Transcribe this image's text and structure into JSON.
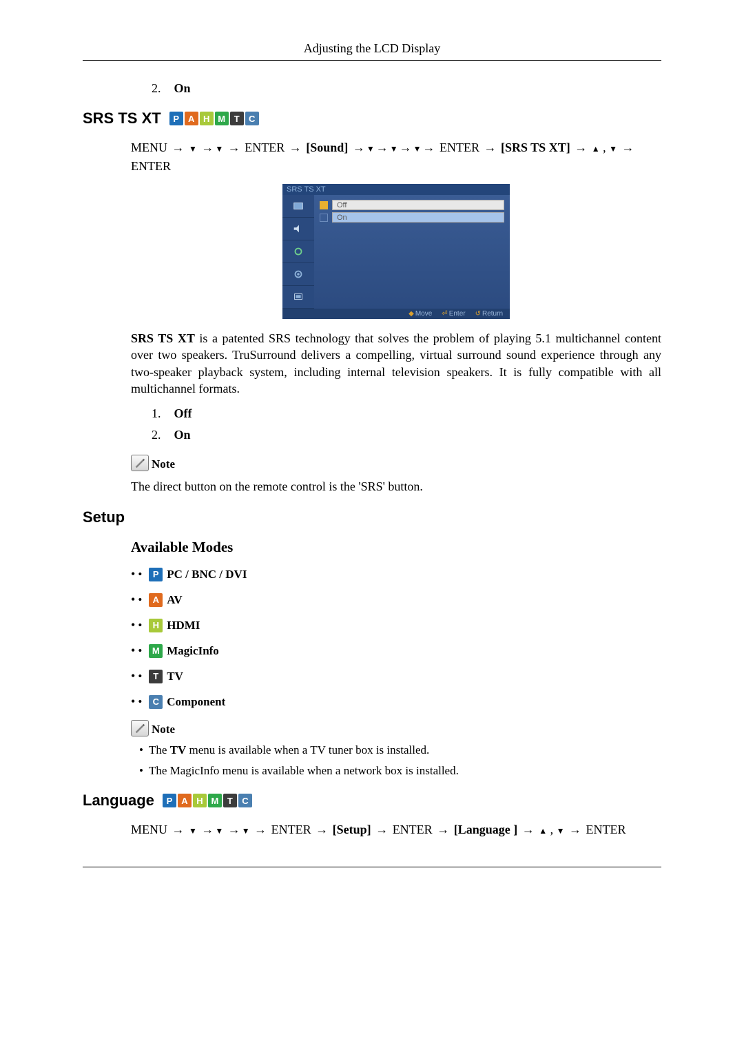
{
  "header": {
    "title": "Adjusting the LCD Display"
  },
  "top_list": {
    "num": "2.",
    "label": "On"
  },
  "section_srs": {
    "title": "SRS TS XT",
    "path_parts": {
      "menu": "MENU",
      "enter": "ENTER",
      "sound": "[Sound]",
      "srs": "[SRS TS XT]"
    },
    "screenshot": {
      "title": "SRS TS XT",
      "opt_off": "Off",
      "opt_on": "On",
      "foot_move": "Move",
      "foot_enter": "Enter",
      "foot_return": "Return"
    },
    "desc_lead": "SRS TS XT",
    "desc_rest": " is a patented SRS technology that solves the problem of playing 5.1 multichannel content over two speakers. TruSurround delivers a compelling, virtual surround sound experience through any two-speaker playback system, including internal television speakers. It is fully compatible with all multichannel formats.",
    "items": [
      {
        "num": "1.",
        "label": "Off"
      },
      {
        "num": "2.",
        "label": "On"
      }
    ],
    "note_label": "Note",
    "note_text": "The direct button on the remote control is the 'SRS' button."
  },
  "section_setup": {
    "title": "Setup",
    "avail_title": "Available Modes",
    "modes": [
      {
        "letter": "P",
        "color": "#1e6fb8",
        "label": " PC / BNC / DVI"
      },
      {
        "letter": "A",
        "color": "#e06a1e",
        "label": " AV"
      },
      {
        "letter": "H",
        "color": "#a8c93a",
        "label": " HDMI"
      },
      {
        "letter": "M",
        "color": "#2ea84a",
        "label": " MagicInfo"
      },
      {
        "letter": "T",
        "color": "#3c3c3c",
        "label": " TV"
      },
      {
        "letter": "C",
        "color": "#4a7fb0",
        "label": " Component"
      }
    ],
    "note_label": "Note",
    "notes": {
      "n1a": "The ",
      "n1b": "TV",
      "n1c": " menu is available when a TV tuner box is installed.",
      "n2": "The MagicInfo menu is available when a network box is installed."
    }
  },
  "section_lang": {
    "title": "Language",
    "path_parts": {
      "menu": "MENU",
      "enter": "ENTER",
      "setup": "[Setup]",
      "language": "[Language ]"
    }
  },
  "badges": [
    {
      "letter": "P",
      "color": "#1e6fb8"
    },
    {
      "letter": "A",
      "color": "#e06a1e"
    },
    {
      "letter": "H",
      "color": "#a8c93a"
    },
    {
      "letter": "M",
      "color": "#2ea84a"
    },
    {
      "letter": "T",
      "color": "#3c3c3c"
    },
    {
      "letter": "C",
      "color": "#4a7fb0"
    }
  ]
}
